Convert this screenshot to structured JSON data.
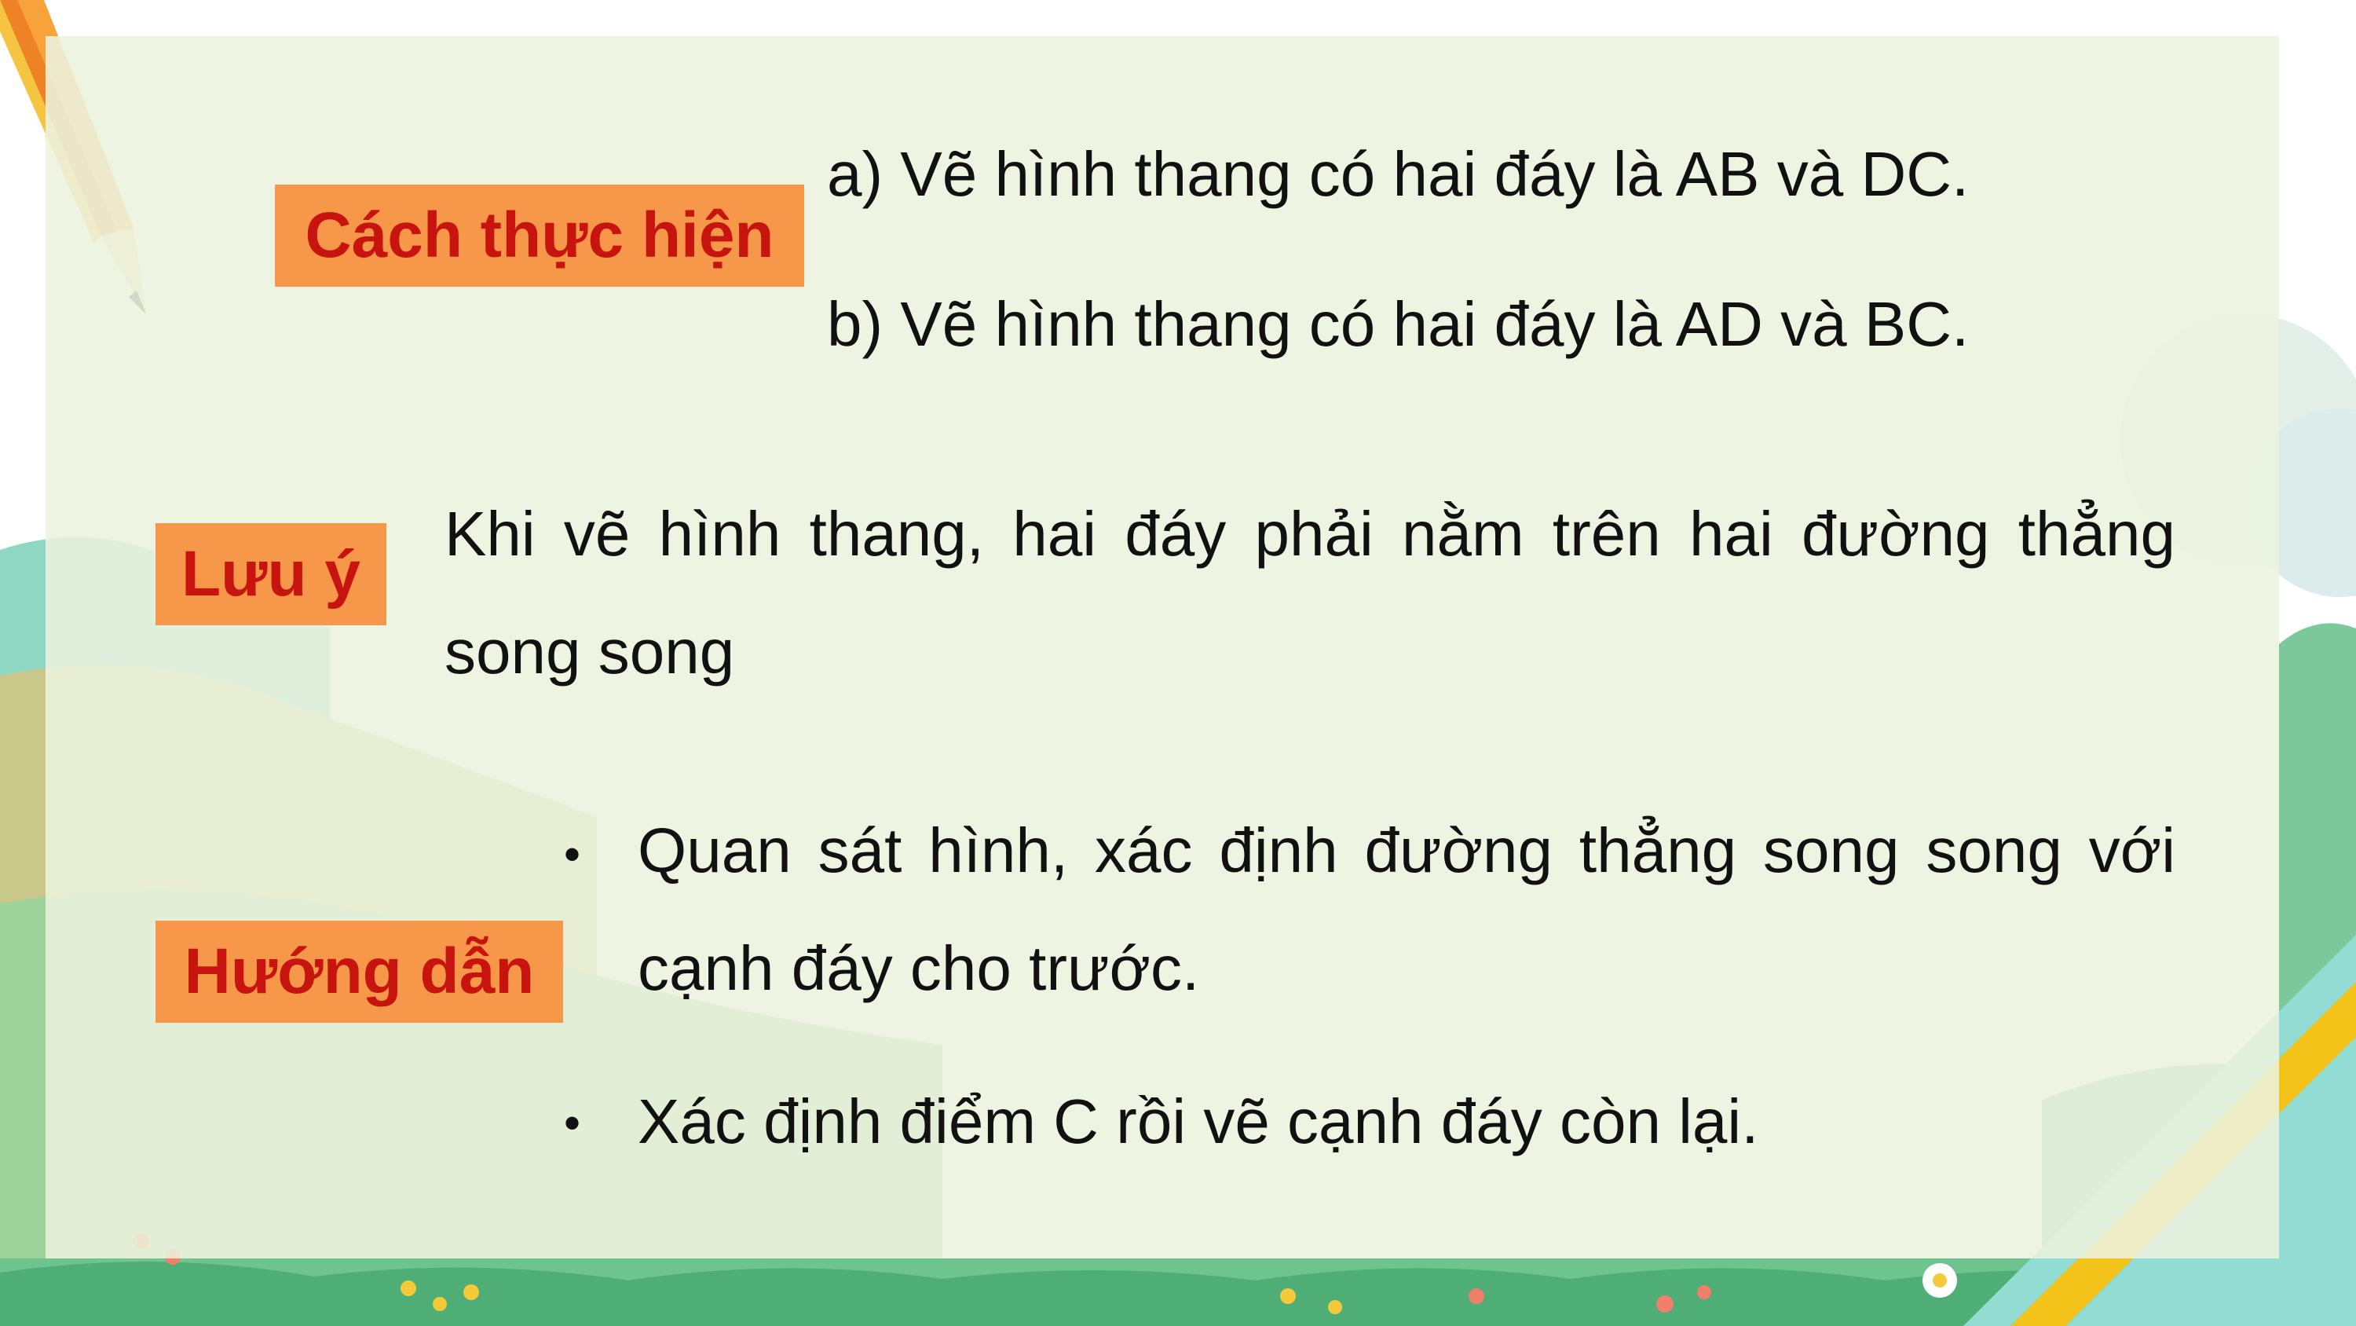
{
  "labels": {
    "cach_thuc_hien": "Cách thực hiện",
    "luu_y": "Lưu ý",
    "huong_dan": "Hướng dẫn"
  },
  "steps": {
    "a": "a) Vẽ hình thang có hai đáy là AB và DC.",
    "b": "b) Vẽ hình thang có hai đáy là AD và BC."
  },
  "note": "Khi vẽ hình thang, hai đáy phải nằm trên hai đường thẳng song song",
  "guide": {
    "bullet_symbol": "•",
    "item1": "Quan sát hình, xác định đường thẳng song song với cạnh đáy cho trước.",
    "item2": "Xác định điểm C rồi vẽ cạnh đáy còn lại."
  },
  "colors": {
    "label_bg": "#f7974a",
    "label_text": "#c8140f",
    "body_text": "#111111"
  }
}
